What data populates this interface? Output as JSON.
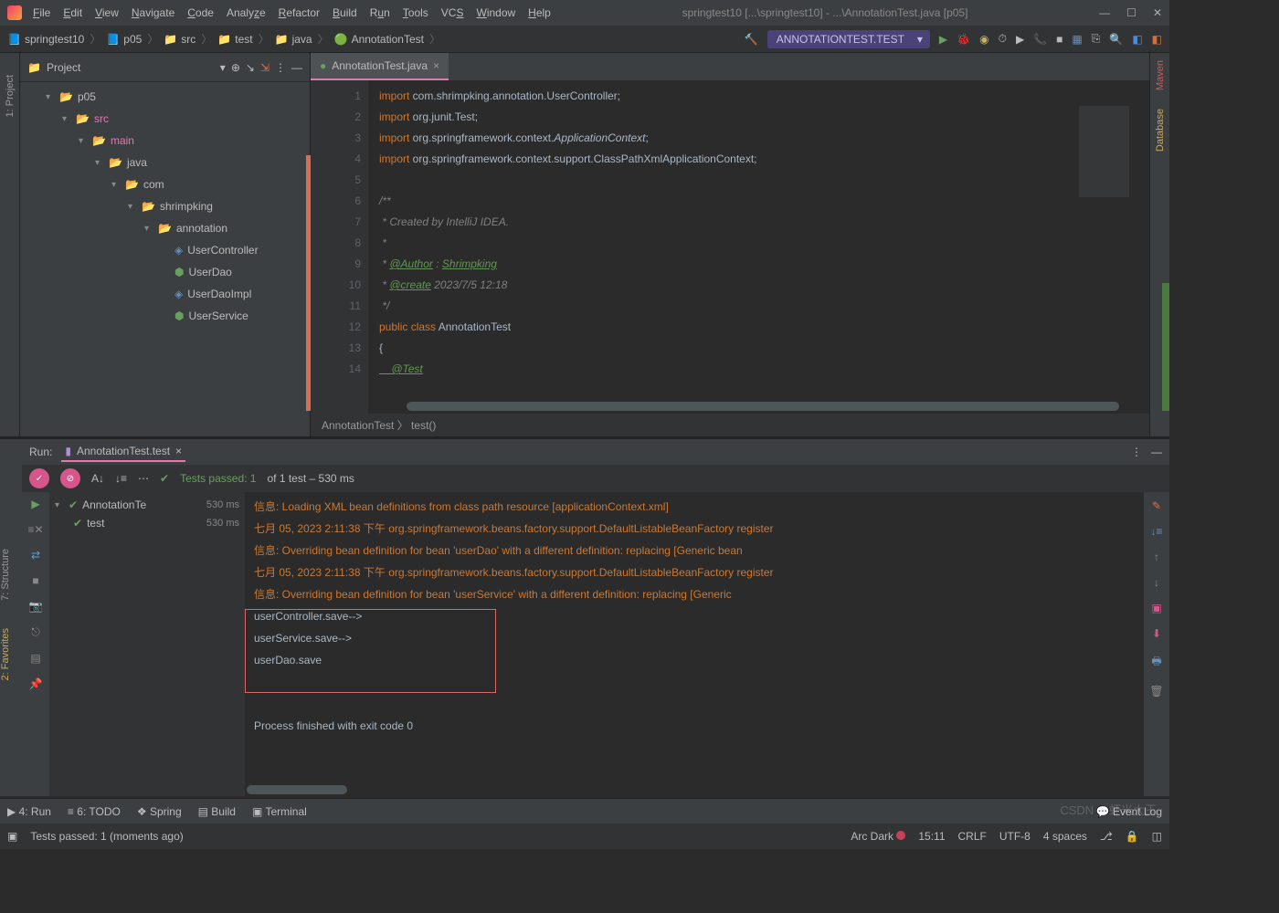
{
  "menu": [
    "File",
    "Edit",
    "View",
    "Navigate",
    "Code",
    "Analyze",
    "Refactor",
    "Build",
    "Run",
    "Tools",
    "VCS",
    "Window",
    "Help"
  ],
  "title": "springtest10 [...\\springtest10] - ...\\AnnotationTest.java [p05]",
  "breadcrumb": [
    "springtest10",
    "p05",
    "src",
    "test",
    "java",
    "AnnotationTest"
  ],
  "runconfig": "ANNOTATIONTEST.TEST",
  "projlabel": "Project",
  "tree": [
    {
      "d": 1,
      "icon": "▾",
      "kind": "redfold",
      "label": "p05"
    },
    {
      "d": 2,
      "icon": "▾",
      "kind": "foldblue",
      "label": "src",
      "cls": "pink"
    },
    {
      "d": 3,
      "icon": "▾",
      "kind": "fold",
      "label": "main",
      "cls": "pink"
    },
    {
      "d": 4,
      "icon": "▾",
      "kind": "foldblue",
      "label": "java"
    },
    {
      "d": 5,
      "icon": "▾",
      "kind": "fold",
      "label": "com"
    },
    {
      "d": 6,
      "icon": "▾",
      "kind": "fold",
      "label": "shrimpking"
    },
    {
      "d": 7,
      "icon": "▾",
      "kind": "fold",
      "label": "annotation"
    },
    {
      "d": 8,
      "icon": "",
      "kind": "jclass",
      "label": "UserController"
    },
    {
      "d": 8,
      "icon": "",
      "kind": "green",
      "label": "UserDao"
    },
    {
      "d": 8,
      "icon": "",
      "kind": "jclass",
      "label": "UserDaoImpl"
    },
    {
      "d": 8,
      "icon": "",
      "kind": "green",
      "label": "UserService"
    }
  ],
  "tab": {
    "name": "AnnotationTest.java"
  },
  "code": {
    "lines": [
      1,
      2,
      3,
      4,
      5,
      6,
      7,
      8,
      9,
      10,
      11,
      12,
      13,
      14
    ],
    "l1a": "import",
    "l1b": " com.shrimpking.annotation.UserController;",
    "l2a": "import",
    "l2b": " org.junit.Test;",
    "l3a": "import",
    "l3b": " org.springframework.context.",
    "l3c": "ApplicationContext",
    "l3d": ";",
    "l4a": "import",
    "l4b": " org.springframework.context.support.ClassPathXmlApplicationContext;",
    "l6": "/**",
    "l7": " * Created by IntelliJ IDEA.",
    "l8": " *",
    "l9a": " * ",
    "l9b": "@Author",
    "l9c": " : ",
    "l9d": "Shrimpking",
    "l10a": " * ",
    "l10b": "@create",
    "l10c": " 2023/7/5 12:18",
    "l11": " */",
    "l12a": "public class",
    "l12b": " AnnotationTest",
    "l13": "{",
    "l14": "    @Test"
  },
  "edcrumb": "AnnotationTest 〉 test()",
  "run": {
    "label": "Run:",
    "tab": "AnnotationTest.test",
    "tests_summary_a": "Tests passed: 1",
    "tests_summary_b": " of 1 test – 530 ms",
    "tree": [
      {
        "label": "AnnotationTe",
        "time": "530 ms",
        "d": 0
      },
      {
        "label": "test",
        "time": "530 ms",
        "d": 1
      }
    ],
    "lines": [
      {
        "t": "orange",
        "v": "信息: Loading XML bean definitions from class path resource [applicationContext.xml]"
      },
      {
        "t": "orange",
        "v": "七月 05, 2023 2:11:38 下午 org.springframework.beans.factory.support.DefaultListableBeanFactory register"
      },
      {
        "t": "orange",
        "v": "信息: Overriding bean definition for bean 'userDao' with a different definition: replacing [Generic bean"
      },
      {
        "t": "orange",
        "v": "七月 05, 2023 2:11:38 下午 org.springframework.beans.factory.support.DefaultListableBeanFactory register"
      },
      {
        "t": "orange",
        "v": "信息: Overriding bean definition for bean 'userService' with a different definition: replacing [Generic "
      },
      {
        "t": "txt",
        "v": "userController.save-->"
      },
      {
        "t": "txt",
        "v": "userService.save-->"
      },
      {
        "t": "txt",
        "v": "userDao.save"
      },
      {
        "t": "txt",
        "v": ""
      },
      {
        "t": "txt",
        "v": ""
      },
      {
        "t": "txt",
        "v": "Process finished with exit code 0"
      }
    ]
  },
  "bottom": [
    "4: Run",
    "6: TODO",
    "Spring",
    "Build",
    "Terminal"
  ],
  "eventlog": "Event Log",
  "status": {
    "msg": "Tests passed: 1 (moments ago)",
    "theme": "Arc Dark",
    "pos": "15:11",
    "eol": "CRLF",
    "enc": "UTF-8",
    "indent": "4 spaces"
  },
  "sidebars": {
    "left": "1: Project",
    "struct": "7: Structure",
    "fav": "2: Favorites",
    "maven": "Maven",
    "db": "Database"
  },
  "watermark": "CSDN @虾米大王"
}
